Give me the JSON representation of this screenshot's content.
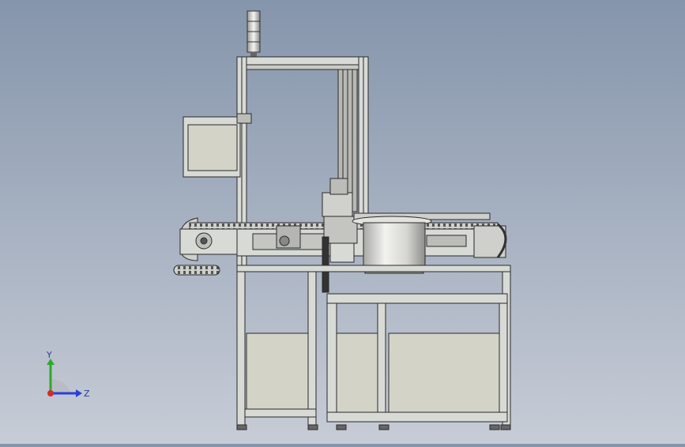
{
  "viewport": {
    "background_top": "#8595ab",
    "background_bottom": "#c7ccd6",
    "model_color_frame": "#d8dad6",
    "model_color_line": "#2a2a2a",
    "model_color_panel": "#d4d3c7"
  },
  "triad": {
    "y_label": "Y",
    "z_label": "Z",
    "y_color": "#2fa82f",
    "z_color": "#2b3fd6",
    "x_color": "#d42b2b"
  }
}
